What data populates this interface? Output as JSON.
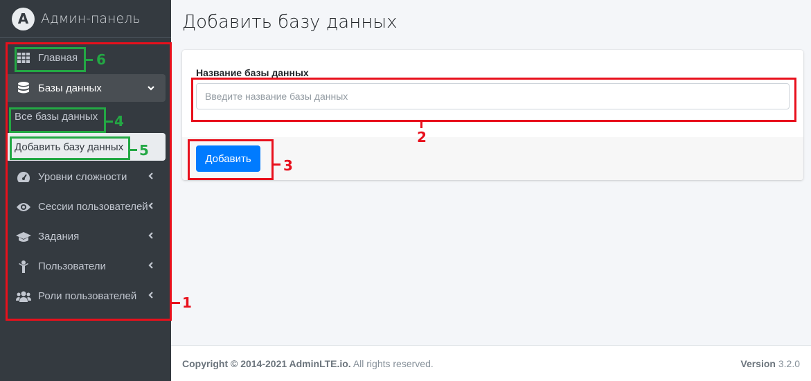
{
  "brand": {
    "logo_letter": "A",
    "title": "Админ-панель"
  },
  "sidebar": {
    "items": [
      {
        "label": "Главная",
        "icon": "grid-icon"
      },
      {
        "label": "Базы данных",
        "icon": "database-icon"
      },
      {
        "label": "Все базы данных"
      },
      {
        "label": "Добавить базу данных"
      },
      {
        "label": "Уровни сложности",
        "icon": "gauge-icon"
      },
      {
        "label": "Сессии пользователей",
        "icon": "eye-icon"
      },
      {
        "label": "Задания",
        "icon": "graduation-cap-icon"
      },
      {
        "label": "Пользователи",
        "icon": "child-icon"
      },
      {
        "label": "Роли пользователей",
        "icon": "users-icon"
      }
    ]
  },
  "main": {
    "title": "Добавить базу данных",
    "form": {
      "label": "Название базы данных",
      "placeholder": "Введите название базы данных",
      "value": "",
      "submit_label": "Добавить"
    }
  },
  "footer": {
    "copyright_bold": "Copyright © 2014-2021 AdminLTE.io.",
    "copyright_rest": " All rights reserved.",
    "version_label": "Version",
    "version_value": " 3.2.0"
  },
  "annotations": [
    "1",
    "2",
    "3",
    "4",
    "5",
    "6"
  ],
  "colors": {
    "sidebar": "#343a40",
    "primary": "#007bff",
    "annotation_red": "#e8101c",
    "annotation_green": "#23a844"
  }
}
